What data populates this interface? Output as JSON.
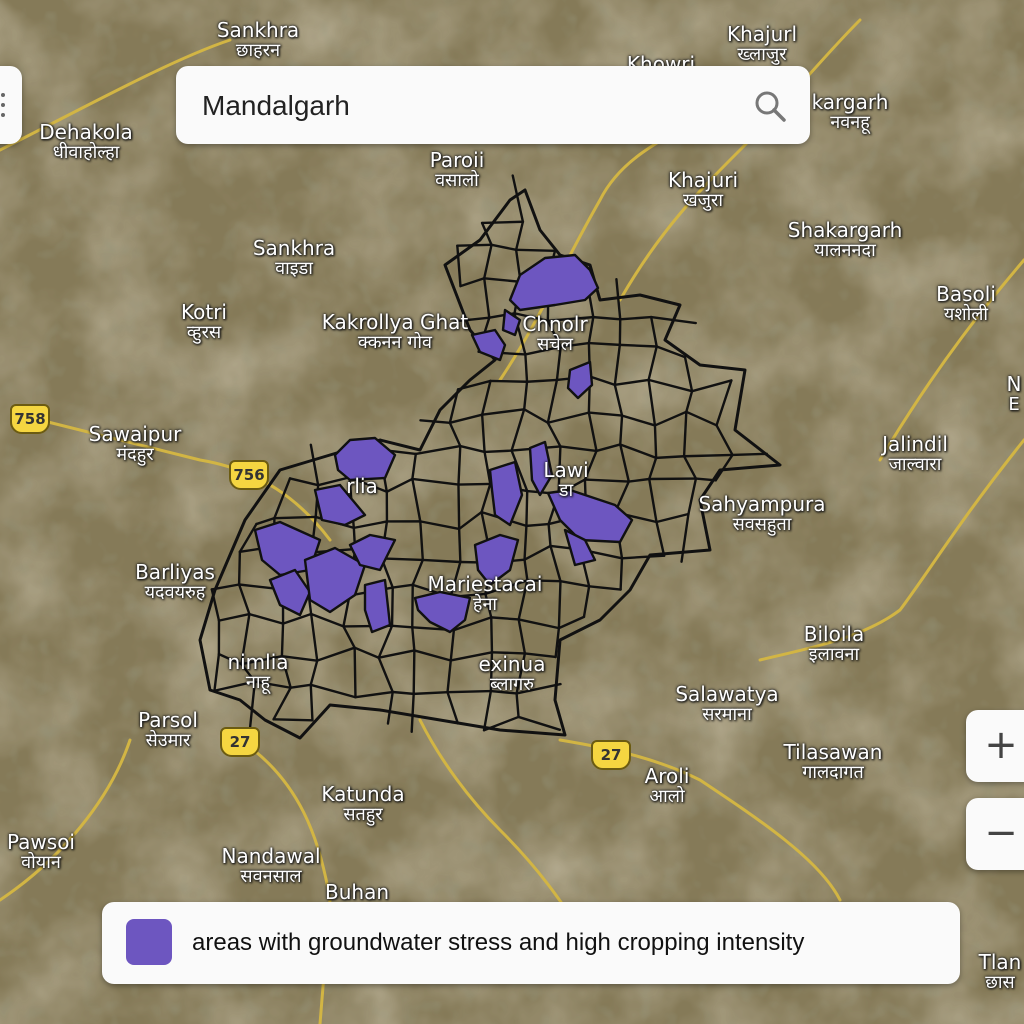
{
  "map": {
    "highway_color": "#d2b544",
    "boundary_color": "#111111",
    "highlight_color": "#6d56c0",
    "places": [
      {
        "en": "Sankhra",
        "hi": "छाहरन"
      },
      {
        "en": "Dehakola",
        "hi": "धीवाहोल्हा"
      },
      {
        "en": "Paroii",
        "hi": "वसालो"
      },
      {
        "en": "Khajurl",
        "hi": "ख्लाजुर"
      },
      {
        "en": "Khowri",
        "hi": ""
      },
      {
        "en": "kargarh",
        "hi": "नवनहू"
      },
      {
        "en": "Khajuri",
        "hi": "खजुरा"
      },
      {
        "en": "Sankhra",
        "hi": "वाइडा"
      },
      {
        "en": "Shakargarh",
        "hi": "यालननदा"
      },
      {
        "en": "Kotri",
        "hi": "व्हुरस"
      },
      {
        "en": "Kakrollya Ghat",
        "hi": "क्कनन गोव"
      },
      {
        "en": "Chnolr",
        "hi": "सचेल"
      },
      {
        "en": "Basoli",
        "hi": "यशोली"
      },
      {
        "en": "Sawaipur",
        "hi": "मंदहुर"
      },
      {
        "en": "Jalindil",
        "hi": "जाल्वारा"
      },
      {
        "en": "Lawi",
        "hi": "डा"
      },
      {
        "en": "Sahyampura",
        "hi": "सवसहुता"
      },
      {
        "en": "rlia",
        "hi": ""
      },
      {
        "en": "Barliyas",
        "hi": "यदवयरुह"
      },
      {
        "en": "Mariestacai",
        "hi": "हेना"
      },
      {
        "en": "Biloila",
        "hi": "इलावना"
      },
      {
        "en": "nimlia",
        "hi": "नाहू"
      },
      {
        "en": "exinua",
        "hi": "ब्लागरु"
      },
      {
        "en": "Salawatya",
        "hi": "सरमाना"
      },
      {
        "en": "Parsol",
        "hi": "सेउमार"
      },
      {
        "en": "Tilasawan",
        "hi": "गालदागत"
      },
      {
        "en": "Aroli",
        "hi": "आलो"
      },
      {
        "en": "Katunda",
        "hi": "सतहुर"
      },
      {
        "en": "Pawsoi",
        "hi": "वोयान"
      },
      {
        "en": "Nandawal",
        "hi": "सवनसाल"
      },
      {
        "en": "Buhan",
        "hi": ""
      },
      {
        "en": "Tlan",
        "hi": "छास"
      },
      {
        "en": "N",
        "hi": "E"
      }
    ],
    "highway_shields": [
      "758",
      "756",
      "27",
      "27"
    ]
  },
  "search": {
    "query": "Mandalgarh",
    "icon": "search-icon"
  },
  "menu": {
    "icon": "more-vertical-icon"
  },
  "zoom": {
    "in_label": "+",
    "out_label": "−"
  },
  "legend": {
    "label": "areas with groundwater stress and high cropping intensity",
    "color": "#6d56c0"
  }
}
